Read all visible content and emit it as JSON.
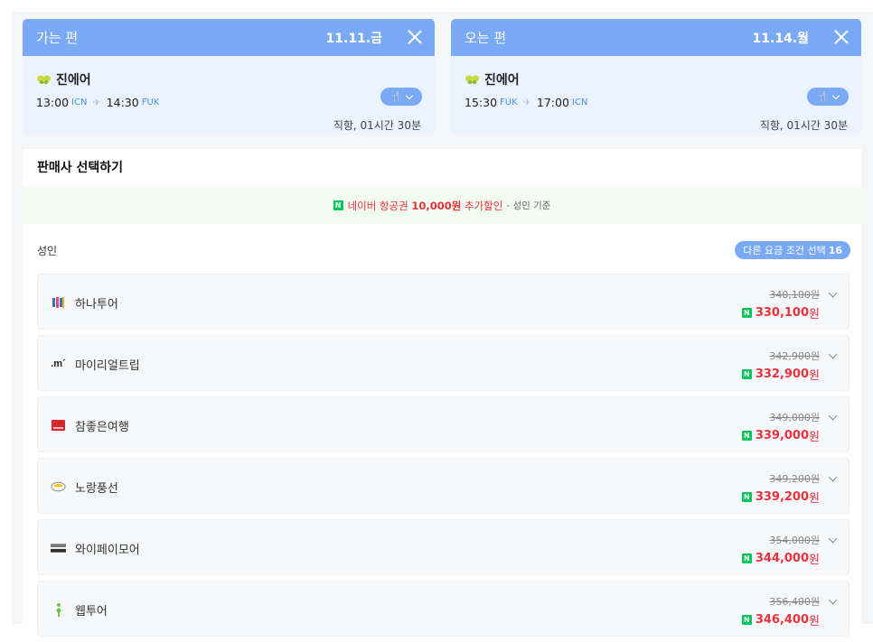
{
  "outbound": {
    "direction": "가는 편",
    "date": "11.11.금",
    "airline": "진에어",
    "dep_time": "13:00",
    "dep_airport": "ICN",
    "arr_time": "14:30",
    "arr_airport": "FUK",
    "route_info": "직항, 01시간 30분",
    "meal_icon": "🍴"
  },
  "inbound": {
    "direction": "오는 편",
    "date": "11.14.월",
    "airline": "진에어",
    "dep_time": "15:30",
    "dep_airport": "FUK",
    "arr_time": "17:00",
    "arr_airport": "ICN",
    "route_info": "직항, 01시간 30분",
    "meal_icon": "🍴"
  },
  "seller_panel": {
    "title": "판매사 선택하기",
    "banner": {
      "badge": "N",
      "prefix": "네이버 항공권 ",
      "amount": "10,000원",
      "suffix": " 추가할인",
      "note": "- 성인 기준"
    },
    "pax_label": "성인",
    "fare_button": {
      "label": "다른 요금 조건 선택",
      "count": "16"
    },
    "sellers": [
      {
        "name": "하나투어",
        "logo": "hanatour-logo",
        "original": "340,100원",
        "price": "330,100",
        "currency": "원"
      },
      {
        "name": "마이리얼트립",
        "logo": "myrealtrip-logo",
        "original": "342,900원",
        "price": "332,900",
        "currency": "원"
      },
      {
        "name": "참좋은여행",
        "logo": "verygoodtour-logo",
        "original": "349,000원",
        "price": "339,000",
        "currency": "원"
      },
      {
        "name": "노랑풍선",
        "logo": "yellowballoon-logo",
        "original": "349,200원",
        "price": "339,200",
        "currency": "원"
      },
      {
        "name": "와이페이모어",
        "logo": "ypaymore-logo",
        "original": "354,000원",
        "price": "344,000",
        "currency": "원"
      },
      {
        "name": "웹투어",
        "logo": "webtour-logo",
        "original": "356,400원",
        "price": "346,400",
        "currency": "원"
      }
    ]
  },
  "colors": {
    "header_blue": "#7aaaf5",
    "card_bg": "#eaf3fe",
    "price_red": "#e8323c",
    "naver_green": "#03c75a",
    "banner_bg": "#f2fcf1"
  }
}
